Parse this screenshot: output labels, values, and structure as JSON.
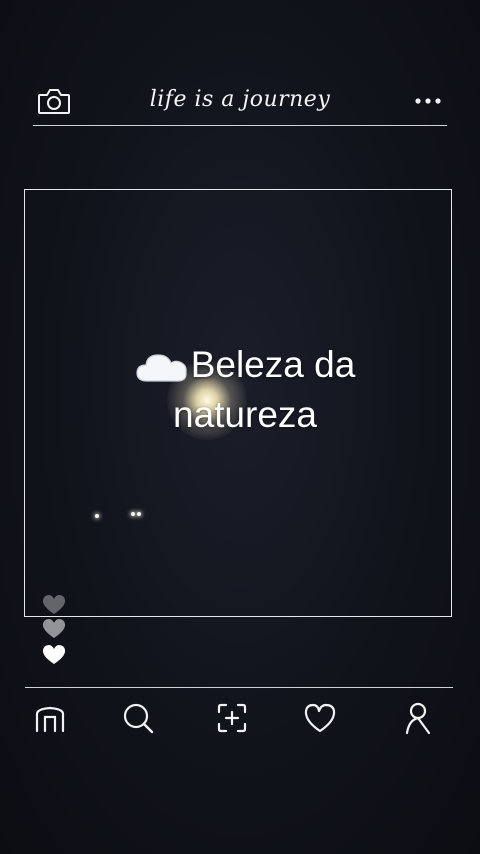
{
  "header": {
    "title": "life is a journey",
    "camera_icon": "camera-icon",
    "more_icon": "more-dots-icon"
  },
  "post": {
    "caption_line1": "Beleza da",
    "caption_line2": "natureza",
    "caption_icon": "cloud-icon"
  },
  "reactions": {
    "hearts": [
      "heart-icon",
      "heart-icon",
      "heart-icon"
    ]
  },
  "bottom_nav": {
    "items": [
      {
        "icon": "home-icon"
      },
      {
        "icon": "search-icon"
      },
      {
        "icon": "add-post-icon"
      },
      {
        "icon": "heart-icon"
      },
      {
        "icon": "profile-icon"
      }
    ]
  },
  "colors": {
    "background": "#11131b",
    "line": "#cfd1d8",
    "text": "#ffffff"
  }
}
